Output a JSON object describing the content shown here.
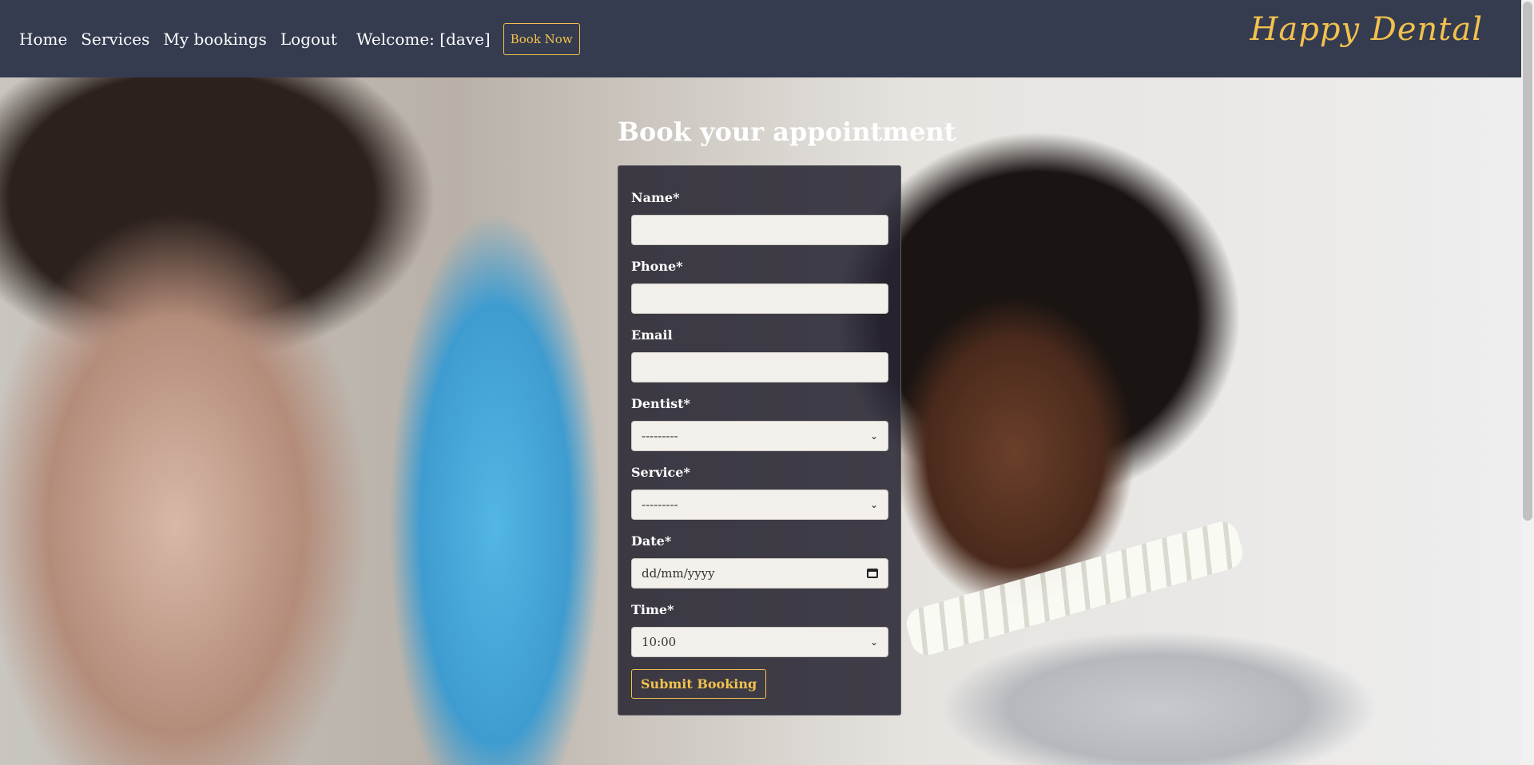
{
  "nav": {
    "home": "Home",
    "services": "Services",
    "my_bookings": "My bookings",
    "logout": "Logout",
    "welcome": "Welcome: [dave]",
    "book_now": "Book Now",
    "brand": "Happy Dental"
  },
  "form": {
    "title": "Book your appointment",
    "name_label": "Name*",
    "name_value": "",
    "phone_label": "Phone*",
    "phone_value": "",
    "email_label": "Email",
    "email_value": "",
    "dentist_label": "Dentist*",
    "dentist_value": "---------",
    "service_label": "Service*",
    "service_value": "---------",
    "date_label": "Date*",
    "date_placeholder": "dd/mm/yyyy",
    "time_label": "Time*",
    "time_value": "10:00",
    "submit": "Submit Booking"
  },
  "colors": {
    "navbar": "#353c50",
    "accent": "#f2c14e"
  }
}
